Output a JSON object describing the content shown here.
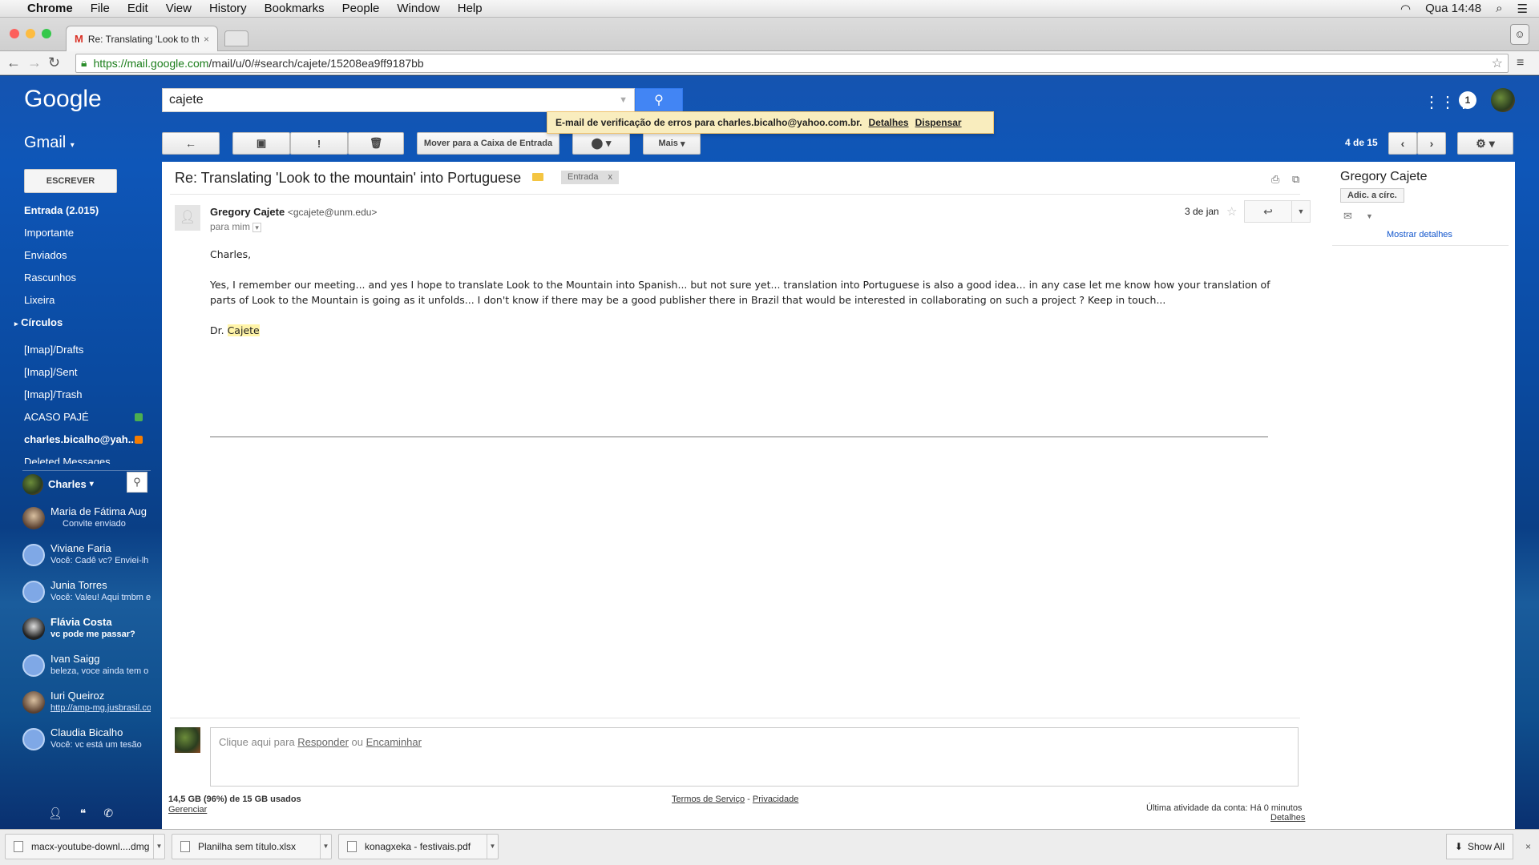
{
  "menubar": {
    "app": "Chrome",
    "items": [
      "File",
      "Edit",
      "View",
      "History",
      "Bookmarks",
      "People",
      "Window",
      "Help"
    ],
    "clock": "Qua 14:48"
  },
  "browser": {
    "tab_title": "Re: Translating 'Look to th",
    "url_host": "https://mail.google.com",
    "url_path": "/mail/u/0/#search/cajete/15208ea9ff9187bb"
  },
  "gmail": {
    "logo": "Google",
    "search_value": "cajete",
    "notification_count": "1",
    "product_label": "Gmail",
    "toolbar": {
      "move_inbox": "Mover para a Caixa de Entrada",
      "more": "Mais",
      "counter": "4 de 15"
    },
    "alert": {
      "text": "E-mail de verificação de erros para charles.bicalho@yahoo.com.br.",
      "details": "Detalhes",
      "dismiss": "Dispensar"
    },
    "compose": "ESCREVER",
    "nav": {
      "inbox": "Entrada (2.015)",
      "important": "Importante",
      "sent": "Enviados",
      "drafts": "Rascunhos",
      "trash": "Lixeira",
      "circles": "Círculos",
      "imap_drafts": "[Imap]/Drafts",
      "imap_sent": "[Imap]/Sent",
      "imap_trash": "[Imap]/Trash",
      "acaso": "ACASO PAJÉ",
      "yahoo": "charles.bicalho@yah...",
      "deleted": "Deleted Messages"
    },
    "label_colors": {
      "acaso": "#4caf50",
      "yahoo": "#f57c00",
      "tag": "#f4c542"
    },
    "chat": {
      "me": "Charles",
      "contacts": [
        {
          "name": "Maria de Fátima Aug",
          "status": "Convite enviado"
        },
        {
          "name": "Viviane Faria",
          "status": "Você: Cadê vc? Enviei-lh"
        },
        {
          "name": "Junia Torres",
          "status": "Você: Valeu! Aqui tmbm e"
        },
        {
          "name": "Flávia Costa",
          "status": "vc pode me passar?"
        },
        {
          "name": "Ivan Saigg",
          "status": "beleza, voce ainda tem o"
        },
        {
          "name": "Iuri Queiroz",
          "status": "http://amp-mg.jusbrasil.co"
        },
        {
          "name": "Claudia Bicalho",
          "status": "Você: vc está um tesão"
        }
      ]
    },
    "email": {
      "subject": "Re: Translating 'Look to the mountain' into Portuguese",
      "label_chip": "Entrada",
      "chip_close": "x",
      "sender_name": "Gregory Cajete",
      "sender_email": "<gcajete@unm.edu>",
      "to": "para mim",
      "date": "3 de jan",
      "greeting": "Charles,",
      "paragraph": "Yes, I remember our meeting... and yes I hope to translate Look to the Mountain into Spanish... but not sure yet... translation into Portuguese is also a good idea... in any case let me know how your translation of parts of Look to the Mountain is going as it unfolds...  I don't know if there may be a good publisher there in Brazil that would be interested in collaborating on such a project ?  Keep in touch...",
      "sign_prefix": "Dr. ",
      "sign_name": "Cajete"
    },
    "reply": {
      "prefix": "Clique aqui para ",
      "reply": "Responder",
      "or": " ou ",
      "forward": "Encaminhar"
    },
    "footer": {
      "storage": "14,5 GB (96%) de 15 GB usados",
      "manage": "Gerenciar",
      "terms": "Termos de Serviço",
      "sep": " - ",
      "privacy": "Privacidade",
      "last_activity": "Última atividade da conta: Há 0 minutos",
      "details": "Detalhes"
    },
    "contact_card": {
      "name": "Gregory Cajete",
      "add_circle": "Adic. a círc.",
      "show_details": "Mostrar detalhes"
    }
  },
  "downloads": {
    "items": [
      "macx-youtube-downl....dmg",
      "Planilha sem título.xlsx",
      "konagxeka - festivais.pdf"
    ],
    "show_all": "Show All"
  }
}
